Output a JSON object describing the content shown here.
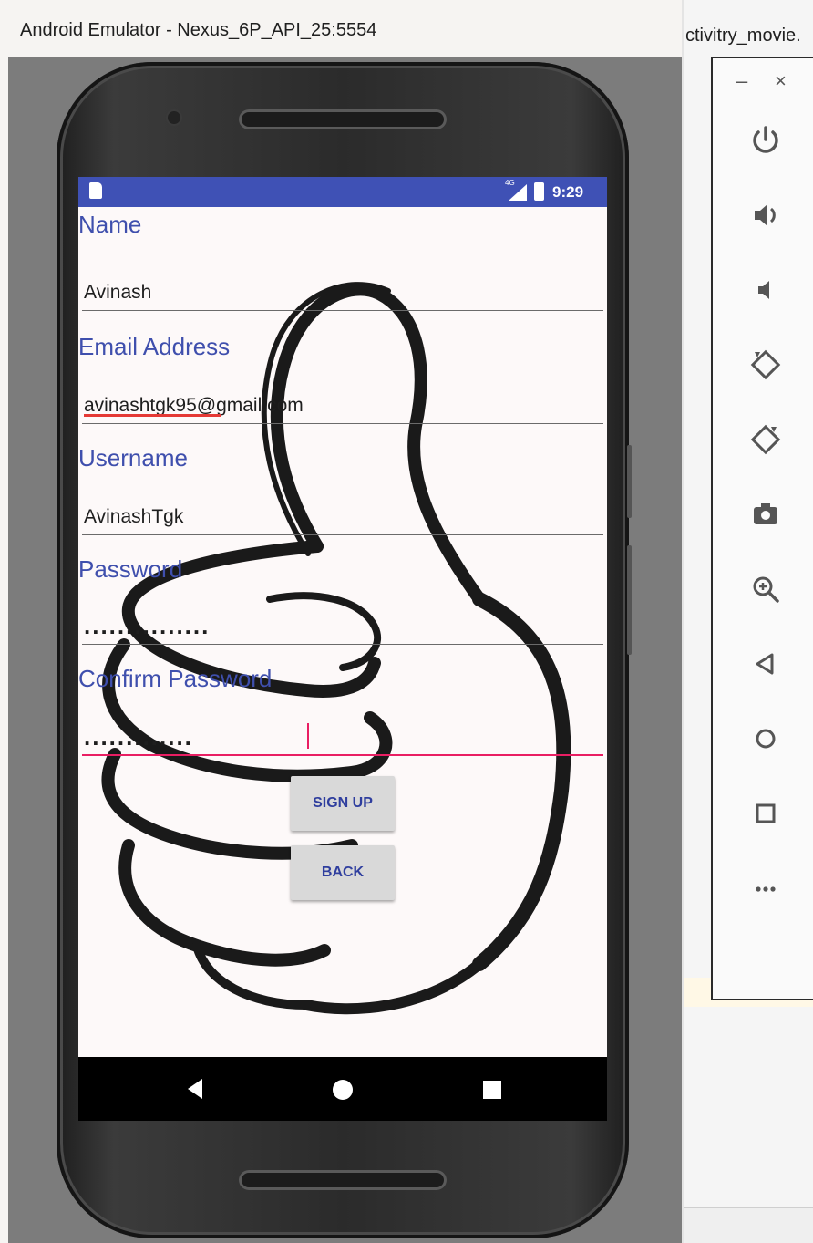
{
  "window": {
    "title": "Android Emulator - Nexus_6P_API_25:5554",
    "side_title": "ctivitry_movie."
  },
  "status_bar": {
    "network": "4G",
    "time": "9:29",
    "background": "#3f51b5"
  },
  "form": {
    "name_label": "Name",
    "name_value": "Avinash",
    "email_label": "Email Address",
    "email_value": "avinashtgk95@gmail.com",
    "username_label": "Username",
    "username_value": "AvinashTgk",
    "password_label": "Password",
    "password_value": "...............",
    "confirm_label": "Confirm Password",
    "confirm_value": "............."
  },
  "buttons": {
    "signup": "SIGN UP",
    "back": "BACK"
  },
  "toolbar": {
    "minimize": "–",
    "close": "×",
    "items": [
      "power-icon",
      "volume-up-icon",
      "volume-down-icon",
      "rotate-left-icon",
      "rotate-right-icon",
      "camera-icon",
      "zoom-icon",
      "back-icon",
      "home-icon",
      "overview-icon",
      "more-icon"
    ]
  },
  "colors": {
    "accent": "#3f4fad",
    "focus_underline": "#e91e63"
  }
}
